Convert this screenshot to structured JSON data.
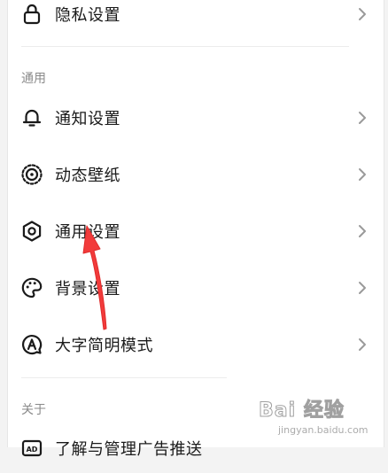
{
  "privacy_row": {
    "label": "隐私设置",
    "icon": "lock-icon"
  },
  "general_section": {
    "title": "通用",
    "items": [
      {
        "label": "通知设置",
        "icon": "bell-icon"
      },
      {
        "label": "动态壁纸",
        "icon": "live-wallpaper-icon"
      },
      {
        "label": "通用设置",
        "icon": "gear-icon"
      },
      {
        "label": "背景设置",
        "icon": "palette-icon"
      },
      {
        "label": "大字简明模式",
        "icon": "font-mode-icon"
      }
    ]
  },
  "about_section": {
    "title": "关于",
    "items": [
      {
        "label": "了解与管理广告推送",
        "icon": "ad-icon"
      }
    ]
  },
  "watermark": {
    "brand": "Bai 经验",
    "url": "jingyan.baidu.com"
  },
  "colors": {
    "background": "#f3f3f3",
    "panel": "#ffffff",
    "text": "#1a1a1a",
    "section_title": "#8a8a8a",
    "chevron": "#9a9a9a",
    "arrow": "#f23b3b"
  }
}
